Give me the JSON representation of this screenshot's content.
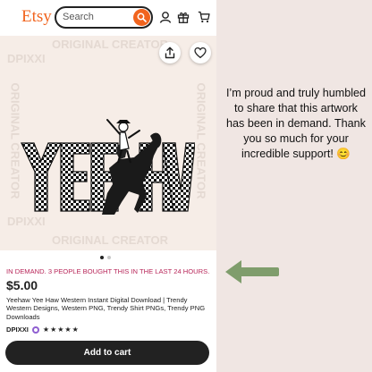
{
  "header": {
    "logo": "Etsy",
    "search_placeholder": "Search",
    "icons": [
      "search-icon",
      "account-icon",
      "gift-icon",
      "cart-icon"
    ]
  },
  "image": {
    "watermark": "ORIGINAL CREATOR",
    "watermark_shop": "DPIXXI",
    "artwork_text": "YEEHAW",
    "share_icon": "share-icon",
    "favorite_icon": "heart-icon",
    "carousel_pages": 2,
    "carousel_active": 1
  },
  "listing": {
    "demand_text": "IN DEMAND. 3 PEOPLE BOUGHT THIS IN THE LAST 24 HOURS.",
    "price": "$5.00",
    "title": "Yeehaw Yee Haw Western Instant Digital Download | Trendy Western Designs, Western PNG, Trendy Shirt PNGs, Trendy PNG Downloads",
    "shop_name": "DPIXXI",
    "rating_stars": "★★★★★",
    "rating": 5,
    "add_to_cart_label": "Add to cart"
  },
  "caption": {
    "text": "I’m proud and truly humbled to share that this artwork has been in demand. Thank you so much for your incredible support! 😊"
  },
  "colors": {
    "brand": "#f1641e",
    "demand": "#b8275a",
    "arrow": "#7f9d6c",
    "background": "#f0e6e3"
  }
}
